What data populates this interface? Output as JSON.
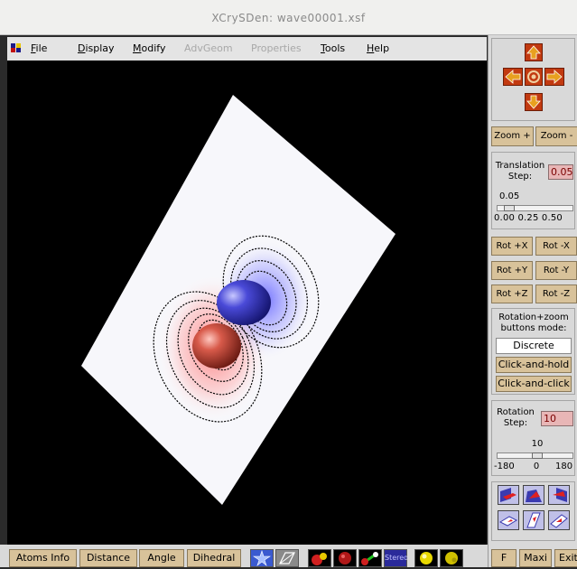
{
  "window": {
    "title": "XCrySDen: wave00001.xsf"
  },
  "menu": [
    {
      "label": "File",
      "disabled": false
    },
    {
      "label": "Display",
      "disabled": false
    },
    {
      "label": "Modify",
      "disabled": false
    },
    {
      "label": "AdvGeom",
      "disabled": true
    },
    {
      "label": "Properties",
      "disabled": true
    },
    {
      "label": "Tools",
      "disabled": false
    },
    {
      "label": "Help",
      "disabled": false
    }
  ],
  "zoom": {
    "plus": "Zoom +",
    "minus": "Zoom -"
  },
  "translation": {
    "label": "Translation Step:",
    "value": "0.05",
    "slider_value": "0.05",
    "ticks": "0.00 0.25 0.50",
    "fraction": 0.1
  },
  "rot": {
    "px": "Rot +X",
    "mx": "Rot -X",
    "py": "Rot +Y",
    "my": "Rot -Y",
    "pz": "Rot +Z",
    "mz": "Rot -Z"
  },
  "mode": {
    "label": "Rotation+zoom buttons mode:",
    "discrete": "Discrete",
    "hold": "Click-and-hold",
    "click": "Click-and-click"
  },
  "rotation": {
    "label": "Rotation Step:",
    "value": "10",
    "slider_value": "10",
    "min": "-180",
    "mid": "0",
    "max": "180",
    "fraction": 0.53
  },
  "bottom": {
    "atoms": "Atoms Info",
    "distance": "Distance",
    "angle": "Angle",
    "dihedral": "Dihedral",
    "stereo": "Stereo"
  },
  "right_bottom": {
    "f": "F",
    "maxi": "Maxi",
    "exit": "Exit"
  },
  "colors": {
    "accent_tan": "#d8c29a",
    "arrow": "#c23a10",
    "pink_field": "#e8b6b6",
    "viewport_bg": "#000000"
  }
}
